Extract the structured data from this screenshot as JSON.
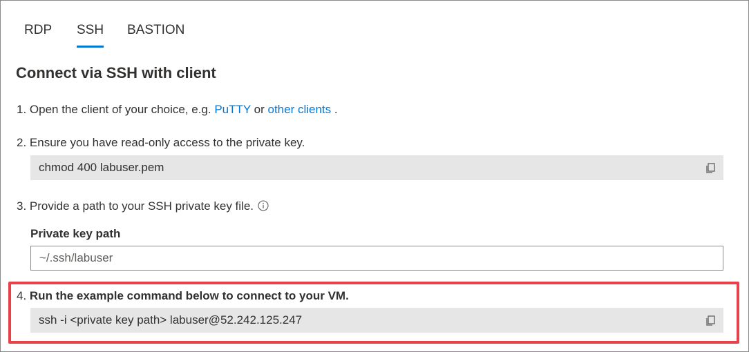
{
  "tabs": [
    {
      "label": "RDP"
    },
    {
      "label": "SSH"
    },
    {
      "label": "BASTION"
    }
  ],
  "heading": "Connect via SSH with client",
  "steps": {
    "s1": {
      "prefix": "1. Open the client of your choice, e.g. ",
      "link1": "PuTTY",
      "middle": " or ",
      "link2": "other clients",
      "suffix": " ."
    },
    "s2": {
      "text": "2. Ensure you have read-only access to the private key.",
      "code": "chmod 400 labuser.pem"
    },
    "s3": {
      "text": "3. Provide a path to your SSH private key file."
    },
    "s4": {
      "number": "4. ",
      "text": "Run the example command below to connect to your VM.",
      "code": "ssh -i <private key path> labuser@52.242.125.247"
    }
  },
  "private_key": {
    "label": "Private key path",
    "placeholder": "~/.ssh/labuser"
  },
  "colors": {
    "accent": "#0078d4",
    "highlight": "#e8414a",
    "code_bg": "#e6e6e6"
  }
}
